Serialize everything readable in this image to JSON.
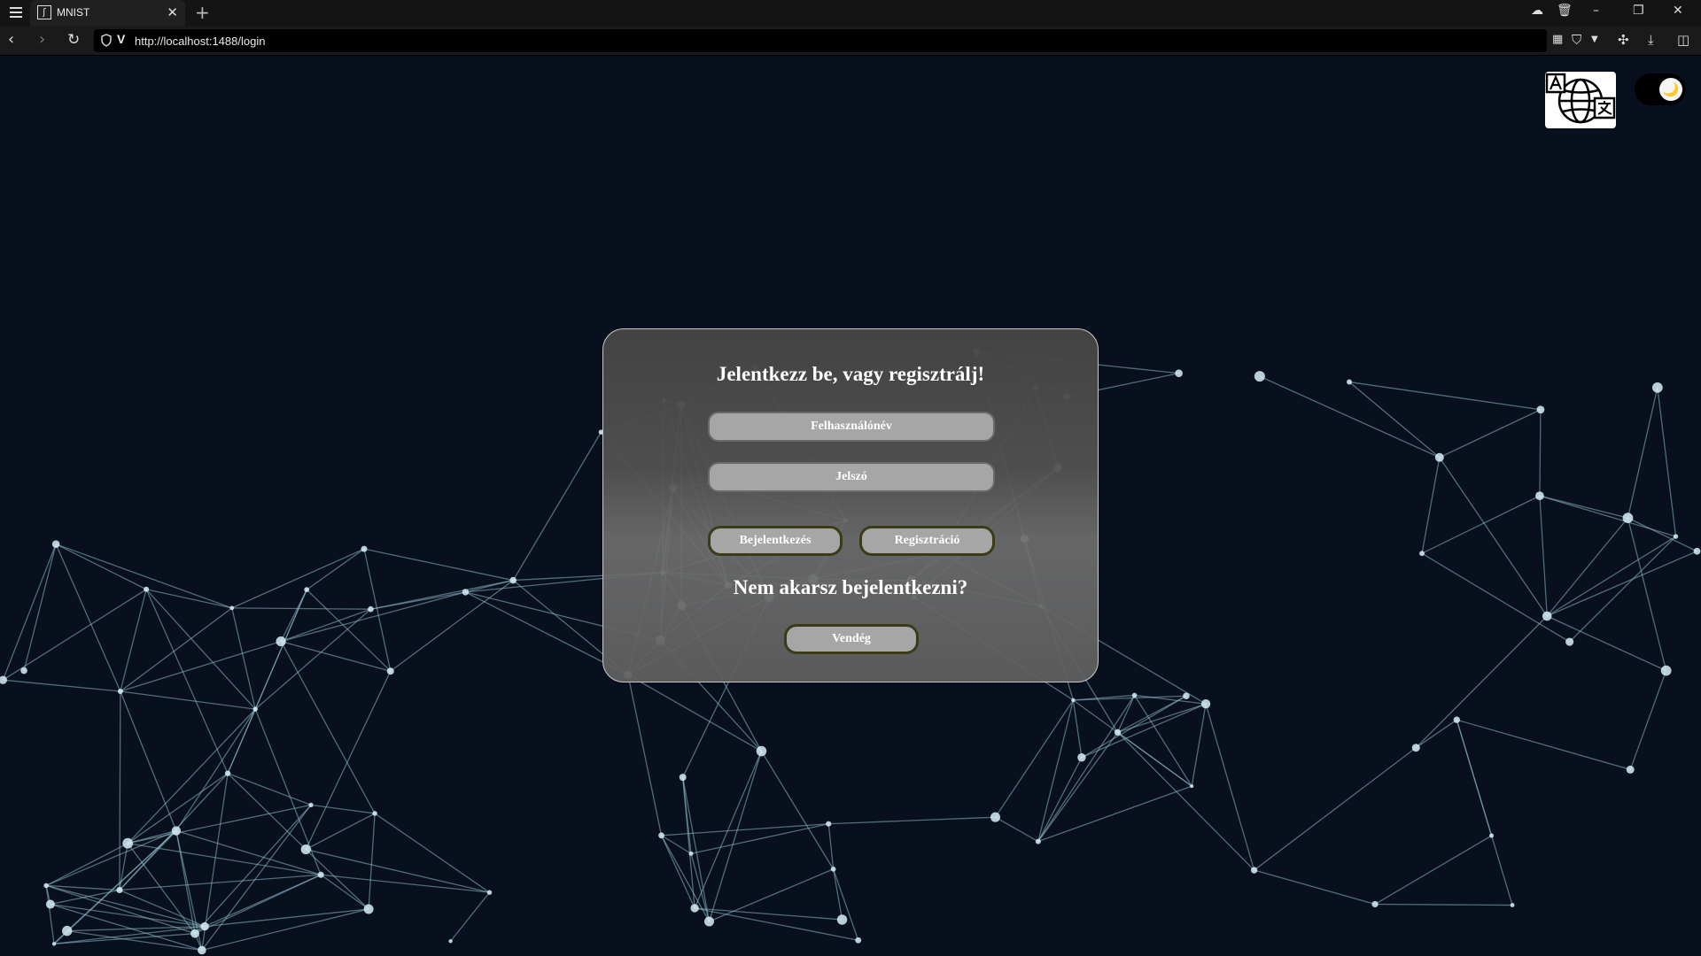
{
  "browser": {
    "tab_title": "MNIST",
    "url": "http://localhost:1488/login"
  },
  "colors": {
    "page_background": "#07101c",
    "network_lines": "#8fb8cc",
    "panel_background": "#555555",
    "input_fill": "#a6a6a6",
    "button_border": "#3b3b18"
  },
  "icons": {
    "translate": "translate-globe-icon",
    "theme": "moon-icon"
  },
  "login": {
    "title": "Jelentkezz be, vagy regisztrálj!",
    "username_placeholder": "Felhasználónév",
    "password_placeholder": "Jelszó",
    "login_label": "Bejelentkezés",
    "register_label": "Regisztráció",
    "guest_prompt": "Nem akarsz bejelentkezni?",
    "guest_label": "Vendég"
  }
}
